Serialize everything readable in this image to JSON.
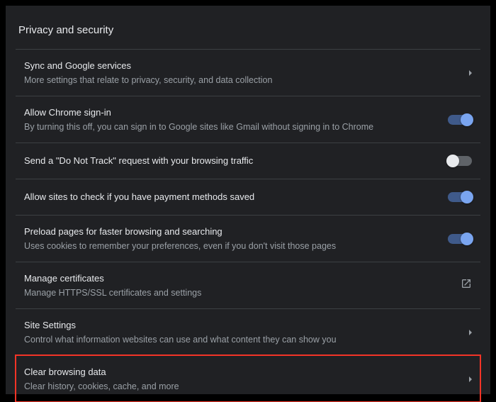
{
  "section_title": "Privacy and security",
  "rows": [
    {
      "title": "Sync and Google services",
      "sub": "More settings that relate to privacy, security, and data collection",
      "action": "chevron"
    },
    {
      "title": "Allow Chrome sign-in",
      "sub": "By turning this off, you can sign in to Google sites like Gmail without signing in to Chrome",
      "action": "toggle",
      "toggle_on": true
    },
    {
      "title": "Send a \"Do Not Track\" request with your browsing traffic",
      "sub": "",
      "action": "toggle",
      "toggle_on": false
    },
    {
      "title": "Allow sites to check if you have payment methods saved",
      "sub": "",
      "action": "toggle",
      "toggle_on": true
    },
    {
      "title": "Preload pages for faster browsing and searching",
      "sub": "Uses cookies to remember your preferences, even if you don't visit those pages",
      "action": "toggle",
      "toggle_on": true
    },
    {
      "title": "Manage certificates",
      "sub": "Manage HTTPS/SSL certificates and settings",
      "action": "external"
    },
    {
      "title": "Site Settings",
      "sub": "Control what information websites can use and what content they can show you",
      "action": "chevron"
    },
    {
      "title": "Clear browsing data",
      "sub": "Clear history, cookies, cache, and more",
      "action": "chevron",
      "highlight": true
    }
  ]
}
